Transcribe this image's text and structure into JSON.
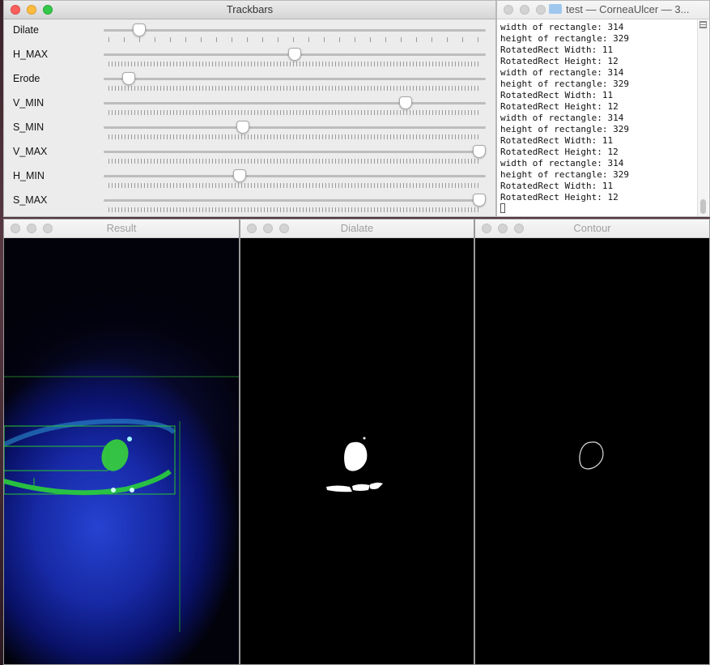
{
  "trackbars_window": {
    "title": "Trackbars",
    "sliders": [
      {
        "label": "Dilate",
        "value_fraction": 0.08,
        "ticks": "sparse"
      },
      {
        "label": "H_MAX",
        "value_fraction": 0.5,
        "ticks": "dense"
      },
      {
        "label": "Erode",
        "value_fraction": 0.05,
        "ticks": "dense"
      },
      {
        "label": "V_MIN",
        "value_fraction": 0.8,
        "ticks": "dense"
      },
      {
        "label": "S_MIN",
        "value_fraction": 0.36,
        "ticks": "dense"
      },
      {
        "label": "V_MAX",
        "value_fraction": 1.0,
        "ticks": "dense"
      },
      {
        "label": "H_MIN",
        "value_fraction": 0.35,
        "ticks": "dense"
      },
      {
        "label": "S_MAX",
        "value_fraction": 1.0,
        "ticks": "dense"
      }
    ]
  },
  "terminal_window": {
    "title": "test — CorneaUlcer — 3...",
    "lines": [
      "width of rectangle: 314",
      "height of rectangle: 329",
      "RotatedRect Width: 11",
      "RotatedRect Height: 12",
      "width of rectangle: 314",
      "height of rectangle: 329",
      "RotatedRect Width: 11",
      "RotatedRect Height: 12",
      "width of rectangle: 314",
      "height of rectangle: 329",
      "RotatedRect Width: 11",
      "RotatedRect Height: 12",
      "width of rectangle: 314",
      "height of rectangle: 329",
      "RotatedRect Width: 11",
      "RotatedRect Height: 12"
    ]
  },
  "result_window": {
    "title": "Result"
  },
  "dialate_window": {
    "title": "Dialate"
  },
  "contour_window": {
    "title": "Contour"
  },
  "colors": {
    "mask_white": "#ffffff",
    "overlay_green": "#22c832",
    "eye_blue": "#2c46dc"
  }
}
